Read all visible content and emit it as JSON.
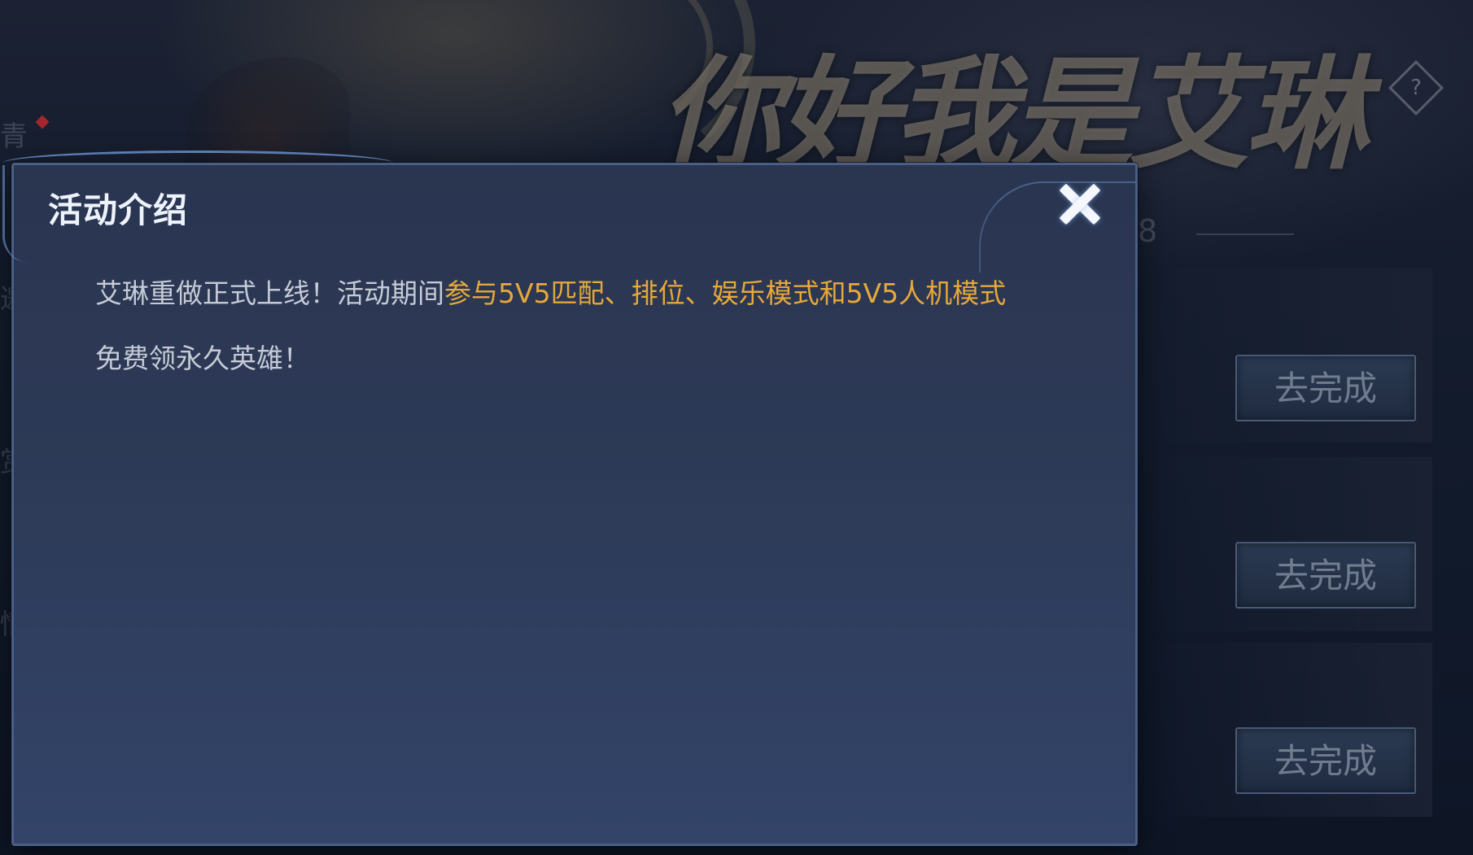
{
  "background": {
    "banner_title": "你好我是艾琳",
    "help_icon_glyph": "?",
    "partial_digit": "8",
    "left_partial_chars": [
      "青",
      "邀",
      "赏",
      "情"
    ],
    "task_buttons": [
      {
        "label": "去完成"
      },
      {
        "label": "去完成"
      },
      {
        "label": "去完成"
      }
    ]
  },
  "modal": {
    "title": "活动介绍",
    "close_icon": "close-icon",
    "description": {
      "line1_plain": "艾琳重做正式上线！活动期间",
      "line1_highlight": "参与5V5匹配、排位、娱乐模式和5V5人机模式",
      "line2_plain": "免费领永久英雄！"
    }
  },
  "colors": {
    "highlight": "#e6a83a",
    "body_text": "#c5cbd6",
    "title_text": "#eef3fb",
    "modal_border": "#4a5e86"
  }
}
